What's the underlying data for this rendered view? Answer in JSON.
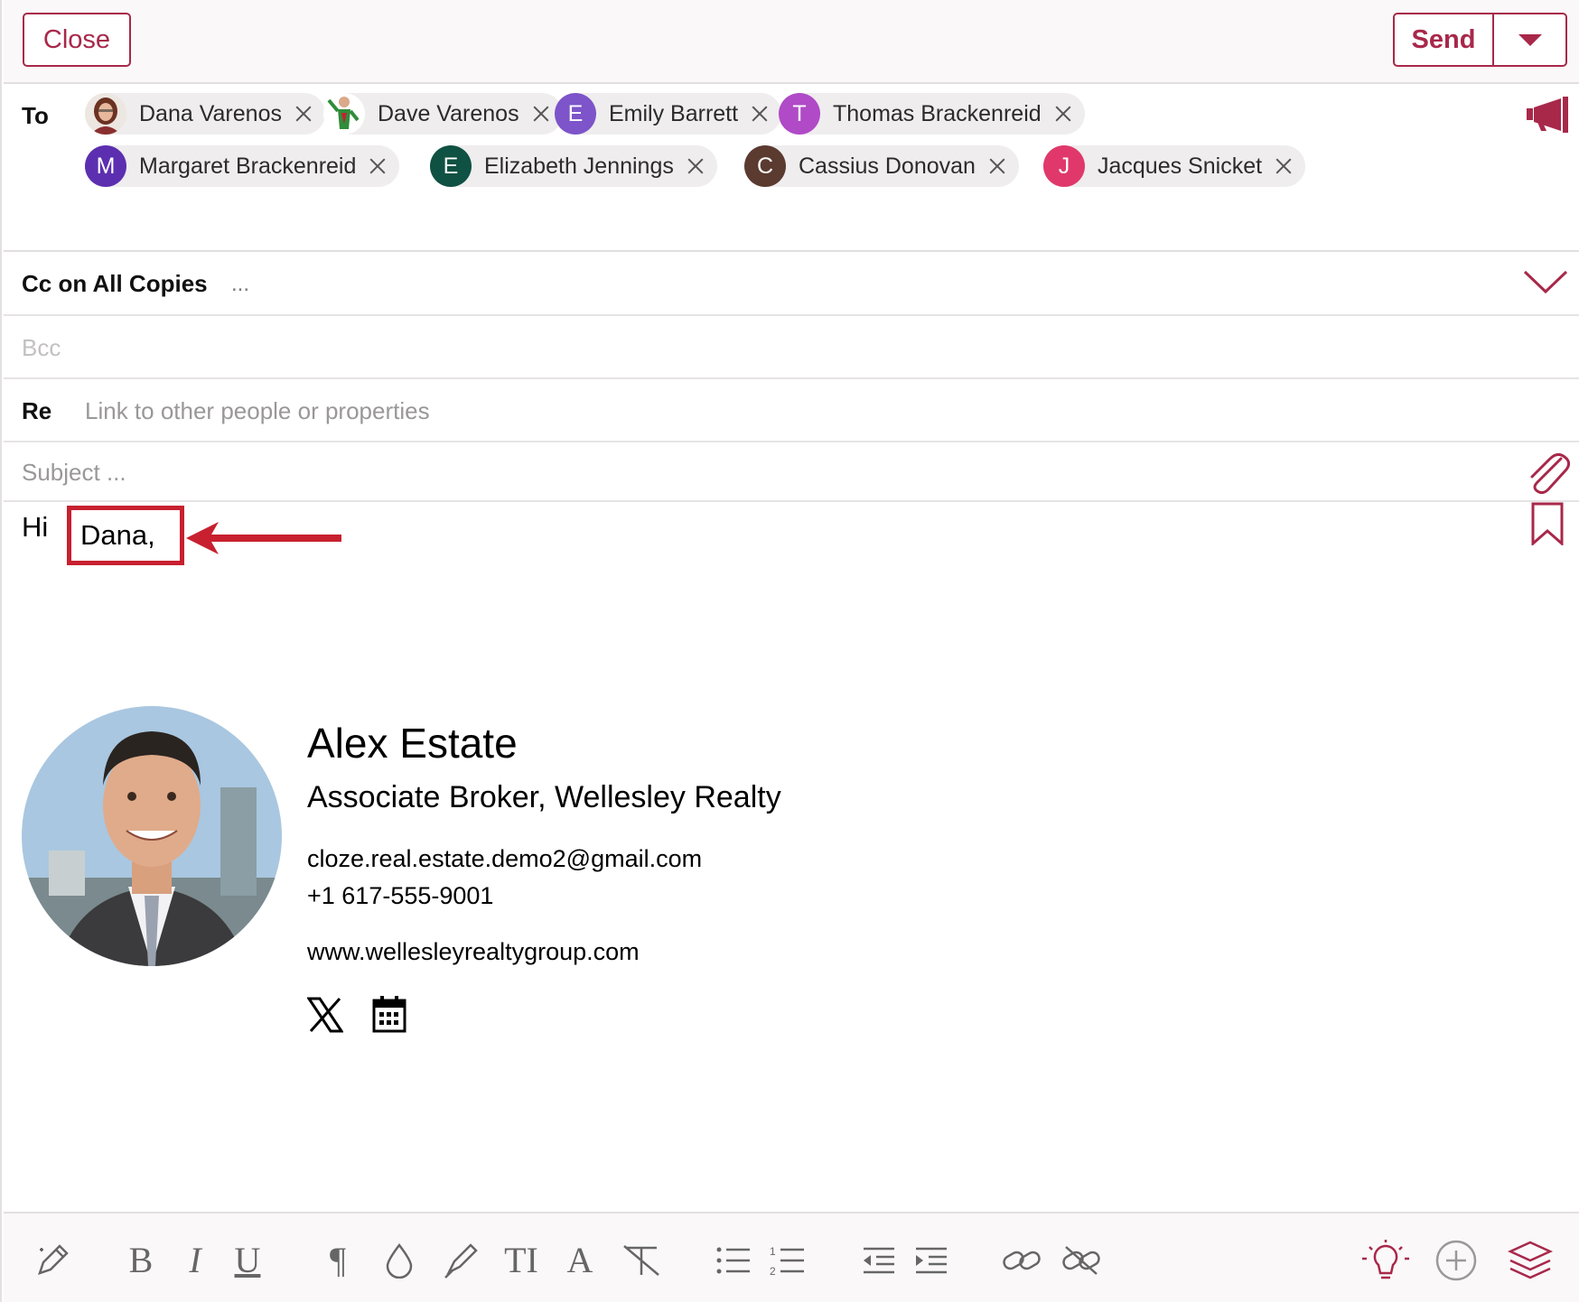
{
  "header": {
    "close_label": "Close",
    "send_label": "Send"
  },
  "to": {
    "label": "To",
    "recipients": [
      {
        "name": "Dana Varenos",
        "initial": "",
        "avatar": "photo",
        "color": "#7a3b2a"
      },
      {
        "name": "Dave Varenos",
        "initial": "",
        "avatar": "photo",
        "color": "#2f6d3a"
      },
      {
        "name": "Emily Barrett",
        "initial": "E",
        "avatar": "initial",
        "color": "#7d54c9"
      },
      {
        "name": "Thomas Brackenreid",
        "initial": "T",
        "avatar": "initial",
        "color": "#b04ac7"
      },
      {
        "name": "Margaret Brackenreid",
        "initial": "M",
        "avatar": "initial",
        "color": "#5c2fb0"
      },
      {
        "name": "Elizabeth Jennings",
        "initial": "E",
        "avatar": "initial",
        "color": "#0f5142"
      },
      {
        "name": "Cassius Donovan",
        "initial": "C",
        "avatar": "initial",
        "color": "#5b3a30"
      },
      {
        "name": "Jacques Snicket",
        "initial": "J",
        "avatar": "initial",
        "color": "#e0386b"
      }
    ]
  },
  "cc": {
    "label": "Cc on All Copies",
    "more": "..."
  },
  "bcc": {
    "placeholder": "Bcc"
  },
  "re": {
    "label": "Re",
    "placeholder": "Link to other people or properties"
  },
  "subject": {
    "placeholder": "Subject ..."
  },
  "body": {
    "greeting_hi": "Hi",
    "greeting_name": "Dana,"
  },
  "signature": {
    "name": "Alex Estate",
    "title": "Associate Broker, Wellesley Realty",
    "email": "cloze.real.estate.demo2@gmail.com",
    "phone": "+1 617-555-9001",
    "website": "www.wellesleyrealtygroup.com",
    "social_icons": [
      "x-logo-icon",
      "calendar-icon"
    ]
  },
  "toolbar": {
    "bold": "B",
    "italic": "I",
    "underline": "U",
    "paragraph": "¶",
    "font_size": "TI",
    "font_color": "A"
  },
  "colors": {
    "accent": "#a8284a",
    "highlight_box": "#c8202f"
  }
}
